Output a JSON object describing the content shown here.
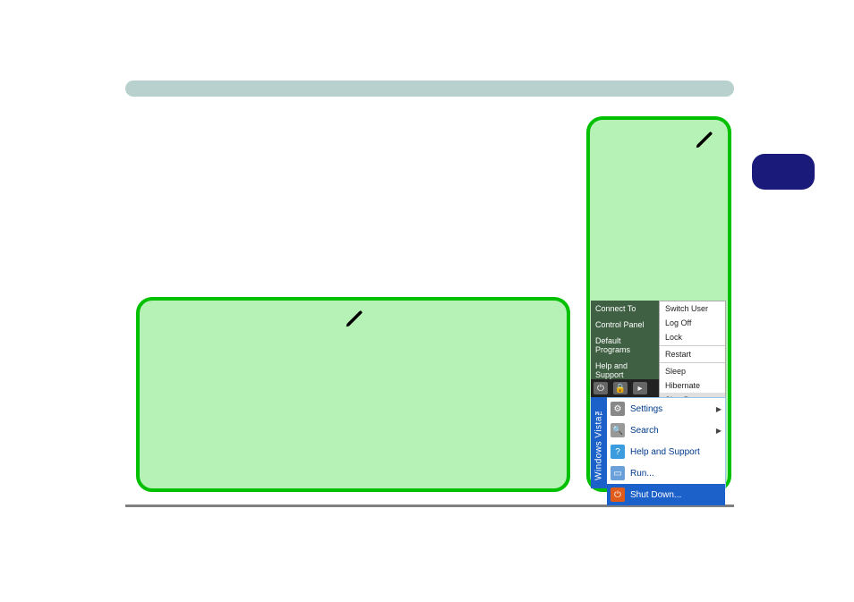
{
  "vista_menu": {
    "left_items": [
      "Connect To",
      "Control Panel",
      "Default Programs",
      "Help and Support"
    ],
    "right_items": [
      {
        "label": "Switch User",
        "highlight": false
      },
      {
        "label": "Log Off",
        "highlight": false
      },
      {
        "label": "Lock",
        "highlight": false
      },
      {
        "label": "Restart",
        "highlight": false
      },
      {
        "label": "Sleep",
        "highlight": false
      },
      {
        "label": "Hibernate",
        "highlight": false
      },
      {
        "label": "Shut Down",
        "highlight": true
      }
    ]
  },
  "xp_menu": {
    "brand_label": "Windows Vista™",
    "items": [
      {
        "label": "Settings",
        "icon": "settings",
        "has_arrow": true
      },
      {
        "label": "Search",
        "icon": "search",
        "has_arrow": true
      },
      {
        "label": "Help and Support",
        "icon": "help",
        "has_arrow": false
      },
      {
        "label": "Run...",
        "icon": "run",
        "has_arrow": false
      },
      {
        "label": "Shut Down...",
        "icon": "shutdown",
        "has_arrow": false,
        "is_shutdown": true
      }
    ]
  }
}
